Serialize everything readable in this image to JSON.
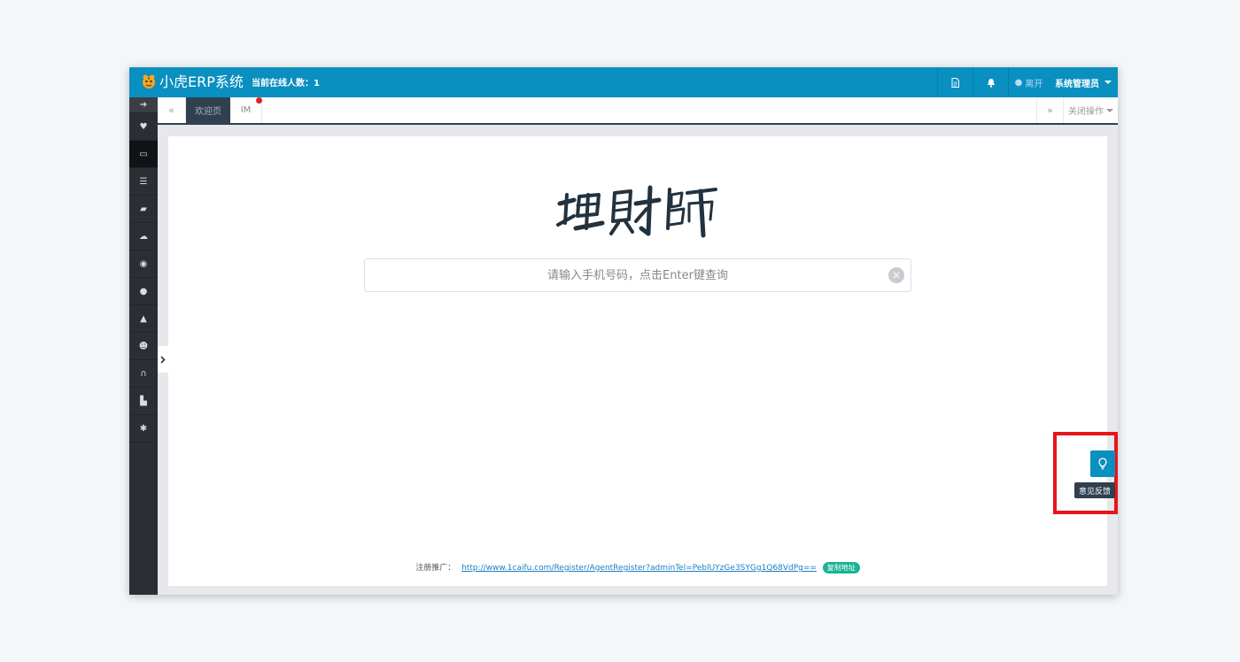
{
  "header": {
    "app_title": "小虎ERP系统",
    "online_label": "当前在线人数：1",
    "leave_label": "离开",
    "user_label": "系统管理员"
  },
  "tabs": {
    "items": [
      {
        "label": "欢迎页",
        "active": true
      },
      {
        "label": "IM",
        "active": false,
        "notification_dot": true
      }
    ],
    "close_ops_label": "关闭操作",
    "prev_glyph": "«",
    "next_glyph": "»"
  },
  "sidebar": {
    "items": [
      {
        "icon": "arrow-right-icon",
        "glyph": "➔"
      },
      {
        "icon": "heart-icon",
        "glyph": "♥"
      },
      {
        "icon": "desktop-icon",
        "glyph": "▭",
        "active": true
      },
      {
        "icon": "list-icon",
        "glyph": "☰"
      },
      {
        "icon": "book-icon",
        "glyph": "▰"
      },
      {
        "icon": "cloud-upload-icon",
        "glyph": "☁"
      },
      {
        "icon": "globe-icon",
        "glyph": "◉"
      },
      {
        "icon": "user-icon",
        "glyph": "●"
      },
      {
        "icon": "road-icon",
        "glyph": "▲"
      },
      {
        "icon": "users-icon",
        "glyph": "☻"
      },
      {
        "icon": "headphones-icon",
        "glyph": "∩"
      },
      {
        "icon": "shopping-cart-icon",
        "glyph": "▙"
      },
      {
        "icon": "gear-icon",
        "glyph": "✱"
      }
    ]
  },
  "main": {
    "logo_text": "理财师",
    "search": {
      "placeholder": "请输入手机号码，点击Enter键查询",
      "value": ""
    },
    "footer": {
      "label": "注册推广：",
      "link": "http://www.1caifu.com/Register/AgentRegister?adminTel=PeblUYzGe3SYGg1Q68VdPg==",
      "copy_label": "复制地址"
    }
  },
  "feedback": {
    "tooltip": "意见反馈"
  },
  "colors": {
    "header": "#0a8fc1",
    "sidebar": "#2b2f35",
    "active_tab": "#2f4050",
    "highlight": "#e8141c",
    "copy_button": "#1ab394"
  }
}
